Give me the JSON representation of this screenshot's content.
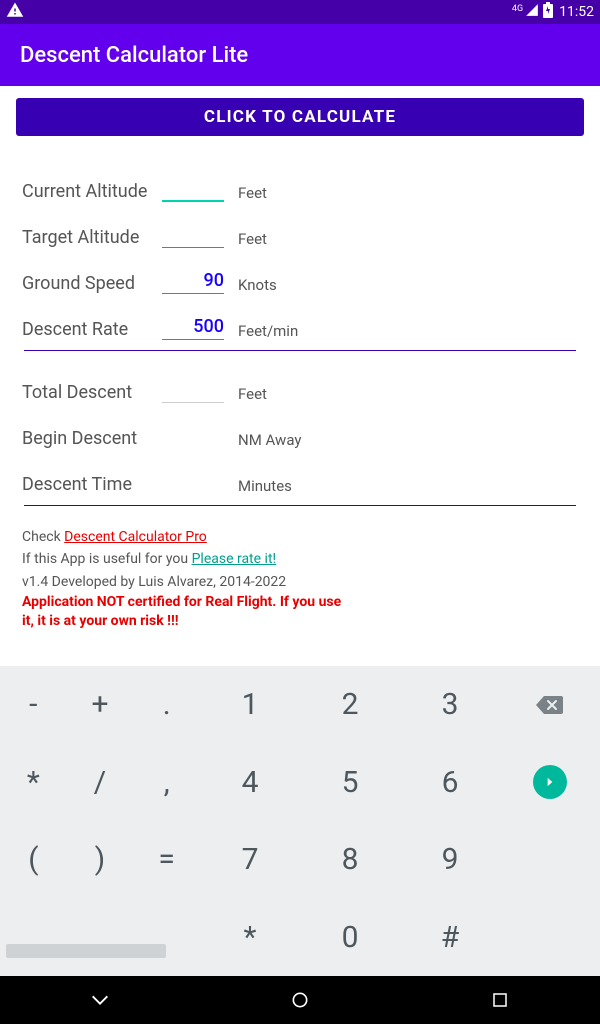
{
  "status": {
    "time": "11:52",
    "signal": "4G"
  },
  "app": {
    "title": "Descent Calculator Lite"
  },
  "button": {
    "calculate": "CLICK TO CALCULATE"
  },
  "inputs": {
    "current_altitude": {
      "label": "Current Altitude",
      "value": "",
      "unit": "Feet"
    },
    "target_altitude": {
      "label": "Target Altitude",
      "value": "",
      "unit": "Feet"
    },
    "ground_speed": {
      "label": "Ground Speed",
      "value": "90",
      "unit": "Knots"
    },
    "descent_rate": {
      "label": "Descent Rate",
      "value": "500",
      "unit": "Feet/min"
    }
  },
  "outputs": {
    "total_descent": {
      "label": "Total Descent",
      "value": "",
      "unit": "Feet"
    },
    "begin_descent": {
      "label": "Begin Descent",
      "value": "",
      "unit": "NM Away"
    },
    "descent_time": {
      "label": "Descent Time",
      "value": "",
      "unit": "Minutes"
    }
  },
  "footer": {
    "check": "Check ",
    "pro_link": "Descent Calculator Pro",
    "useful": "If this App is useful for you ",
    "rate_link": "Please rate it!",
    "version": "v1.4 Developed by Luis Alvarez, 2014-2022",
    "warning": "Application NOT certified for Real Flight. If you use it, it is at your own risk !!!"
  },
  "keypad": {
    "left": [
      "-",
      "+",
      ".",
      "*",
      "/",
      ",",
      "(",
      ")",
      "="
    ],
    "mid": [
      "1",
      "2",
      "3",
      "4",
      "5",
      "6",
      "7",
      "8",
      "9",
      "*",
      "0",
      "#"
    ]
  }
}
